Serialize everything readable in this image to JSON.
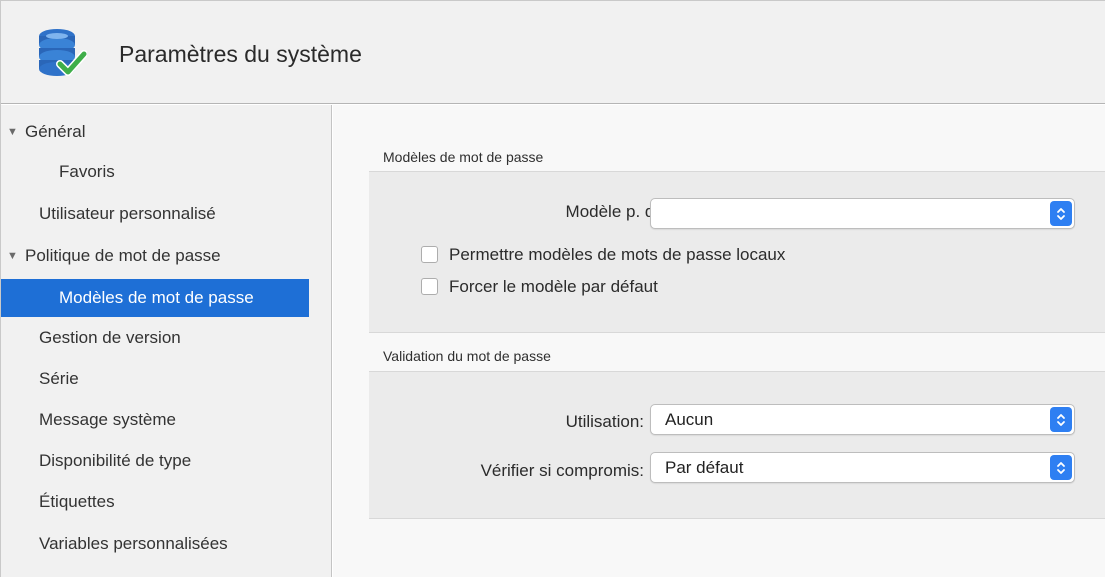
{
  "window": {
    "title": "Paramètres du système"
  },
  "sidebar": {
    "items": [
      {
        "label": "Général",
        "expandable": true
      },
      {
        "label": "Favoris",
        "expandable": false
      },
      {
        "label": "Utilisateur personnalisé",
        "expandable": false
      },
      {
        "label": "Politique de mot de passe",
        "expandable": true
      },
      {
        "label": "Modèles de mot de passe",
        "expandable": false,
        "selected": true
      },
      {
        "label": "Gestion de version",
        "expandable": false
      },
      {
        "label": "Série",
        "expandable": false
      },
      {
        "label": "Message système",
        "expandable": false
      },
      {
        "label": "Disponibilité de type",
        "expandable": false
      },
      {
        "label": "Étiquettes",
        "expandable": false
      },
      {
        "label": "Variables personnalisées",
        "expandable": false
      }
    ],
    "expand_glyph": "▼"
  },
  "password_models": {
    "group_title": "Modèles de mot de passe",
    "default_model": {
      "label": "Modèle p. déf.:",
      "value": ""
    },
    "allow_local": {
      "label": "Permettre modèles de mots de passe locaux",
      "checked": false
    },
    "force_default": {
      "label": "Forcer le modèle par défaut",
      "checked": false
    }
  },
  "password_validation": {
    "group_title": "Validation du mot de passe",
    "usage": {
      "label": "Utilisation:",
      "value": "Aucun"
    },
    "check_compromised": {
      "label": "Vérifier si compromis:",
      "value": "Par défaut"
    }
  },
  "colors": {
    "selection": "#1e6fd6",
    "stepper": "#2e7ff2",
    "sidebar_bg": "#f1f1f1",
    "content_bg": "#f8f8f8"
  }
}
